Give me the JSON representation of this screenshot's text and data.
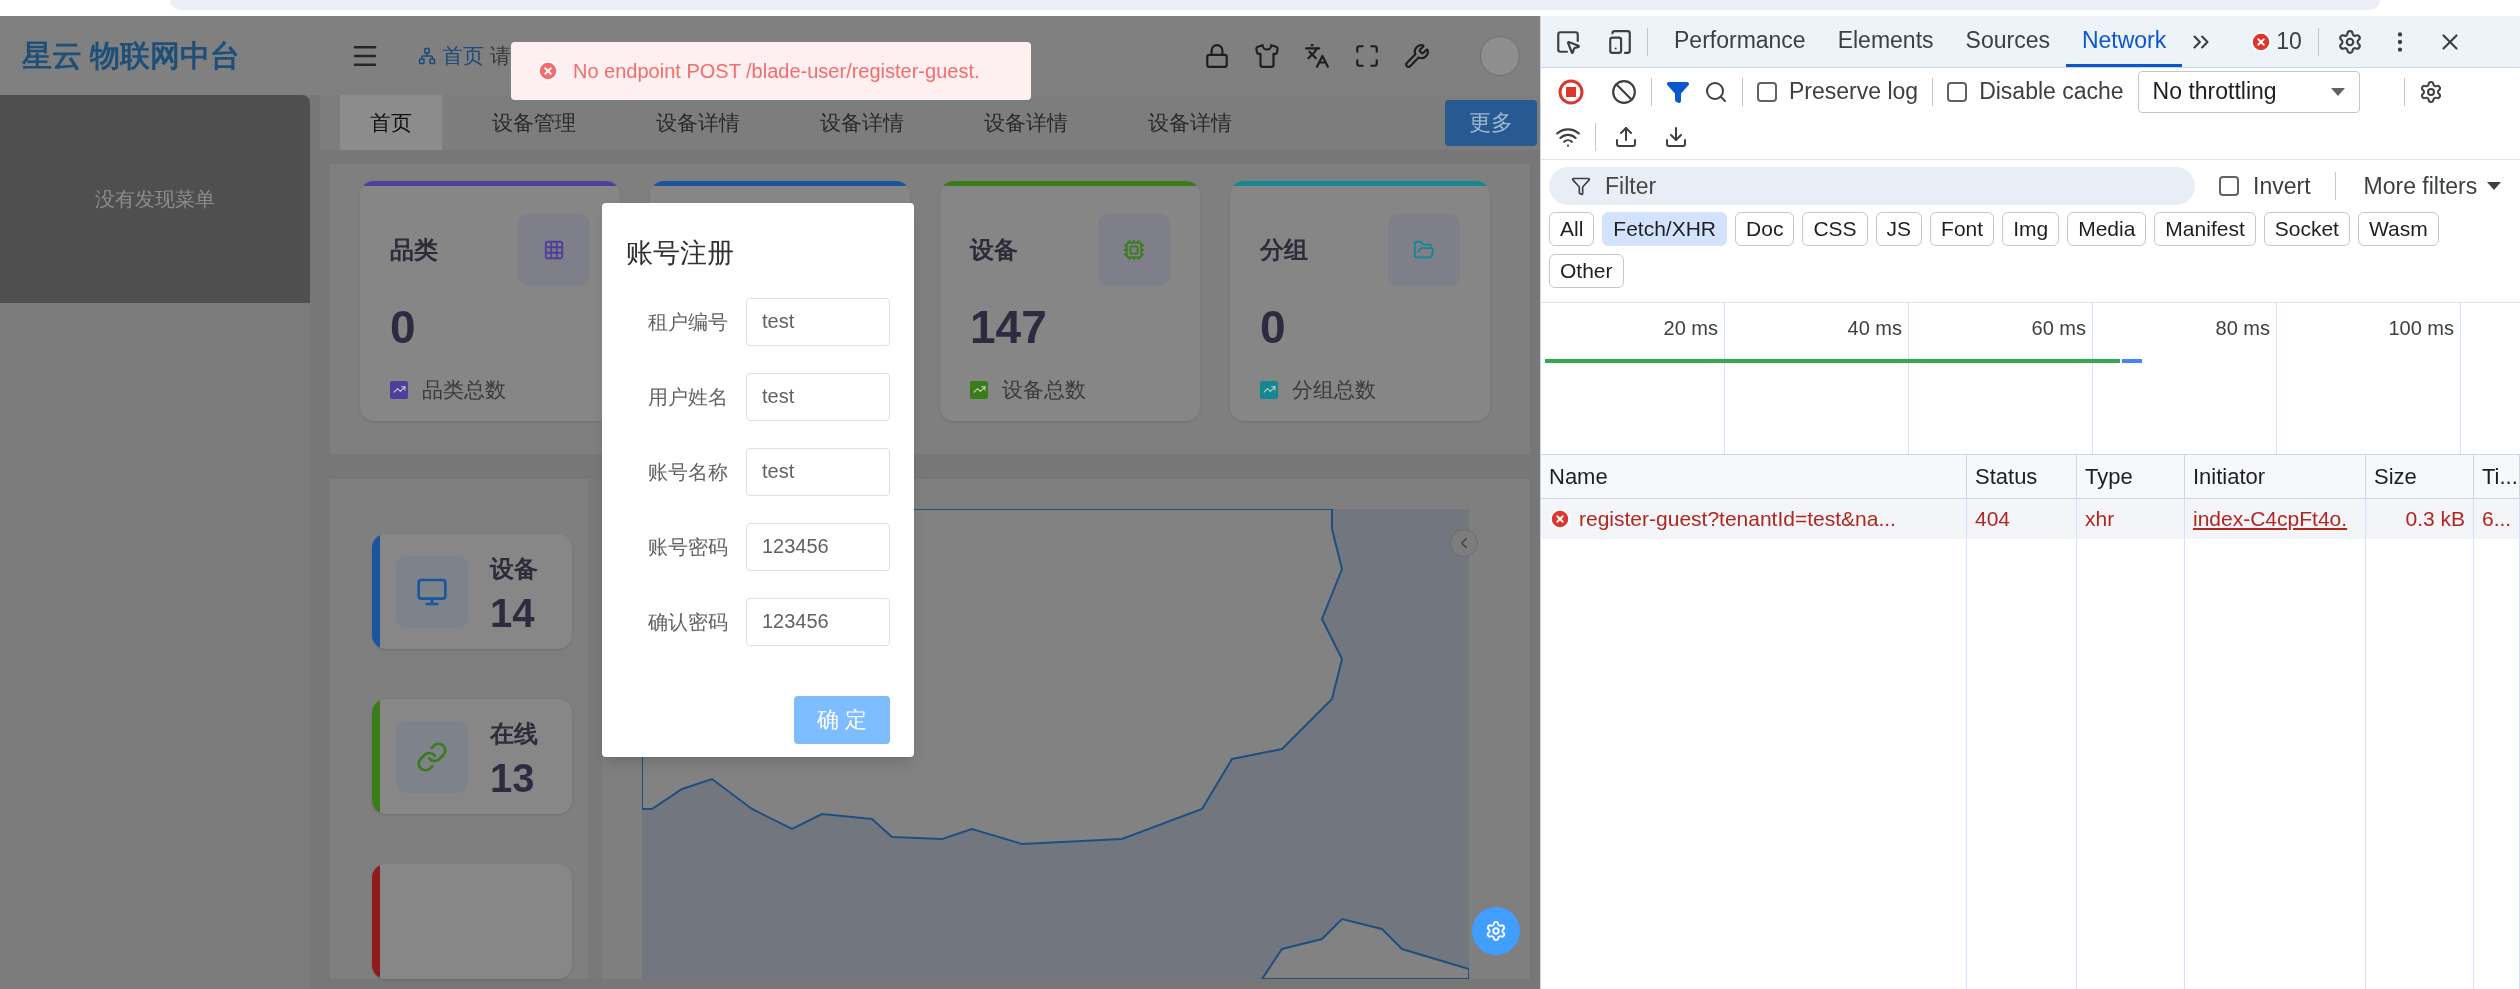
{
  "toast": {
    "message": "No endpoint POST /blade-user/register-guest."
  },
  "header": {
    "logo": "星云 物联网中台",
    "breadcrumb": "首页",
    "breadcrumb_tail": "请"
  },
  "sidebar": {
    "empty_text": "没有发现菜单"
  },
  "tabs": [
    {
      "label": "首页",
      "selected": true
    },
    {
      "label": "设备管理",
      "selected": false
    },
    {
      "label": "设备详情",
      "selected": false
    },
    {
      "label": "设备详情",
      "selected": false
    },
    {
      "label": "设备详情",
      "selected": false
    },
    {
      "label": "设备详情",
      "selected": false
    }
  ],
  "more_button": "更多",
  "stat_cards": [
    {
      "title": "品类",
      "value": "0",
      "caption": "品类总数",
      "color": "#4f3f9c"
    },
    {
      "color": "#1a56a0"
    },
    {
      "title": "设备",
      "value": "147",
      "caption": "设备总数",
      "color": "#3a7d18"
    },
    {
      "title": "分组",
      "value": "0",
      "caption": "分组总数",
      "color": "#138891"
    }
  ],
  "summary_cards": [
    {
      "title": "设备",
      "value": "14",
      "color": "#1a56a0"
    },
    {
      "title": "在线",
      "value": "13",
      "color": "#3a7d18"
    },
    {
      "color": "#8f1c1c"
    }
  ],
  "dialog": {
    "title": "账号注册",
    "fields": [
      {
        "label": "租户编号",
        "value": "test"
      },
      {
        "label": "用户姓名",
        "value": "test"
      },
      {
        "label": "账号名称",
        "value": "test"
      },
      {
        "label": "账号密码",
        "value": "123456"
      },
      {
        "label": "确认密码",
        "value": "123456"
      }
    ],
    "confirm": "确 定"
  },
  "devtools": {
    "tabs": [
      {
        "label": "Performance",
        "selected": false
      },
      {
        "label": "Elements",
        "selected": false
      },
      {
        "label": "Sources",
        "selected": false
      },
      {
        "label": "Network",
        "selected": true
      }
    ],
    "error_count": "10",
    "preserve_log": {
      "label": "Preserve log",
      "checked": false
    },
    "disable_cache": {
      "label": "Disable cache",
      "checked": false
    },
    "throttling": "No throttling",
    "filter_placeholder": "Filter",
    "invert": {
      "label": "Invert",
      "checked": false
    },
    "more_filters": "More filters",
    "type_filters": [
      {
        "label": "All",
        "selected": false
      },
      {
        "label": "Fetch/XHR",
        "selected": true
      },
      {
        "label": "Doc",
        "selected": false
      },
      {
        "label": "CSS",
        "selected": false
      },
      {
        "label": "JS",
        "selected": false
      },
      {
        "label": "Font",
        "selected": false
      },
      {
        "label": "Img",
        "selected": false
      },
      {
        "label": "Media",
        "selected": false
      },
      {
        "label": "Manifest",
        "selected": false
      },
      {
        "label": "Socket",
        "selected": false
      },
      {
        "label": "Wasm",
        "selected": false
      },
      {
        "label": "Other",
        "selected": false
      }
    ],
    "timeline_ticks": [
      "20 ms",
      "40 ms",
      "60 ms",
      "80 ms",
      "100 ms"
    ],
    "columns": [
      "Name",
      "Status",
      "Type",
      "Initiator",
      "Size",
      "Ti..."
    ],
    "requests": [
      {
        "name": "register-guest?tenantId=test&na...",
        "status": "404",
        "type": "xhr",
        "initiator": "index-C4cpFt4o.",
        "size": "0.3 kB",
        "time": "6...",
        "failed": true
      }
    ]
  }
}
